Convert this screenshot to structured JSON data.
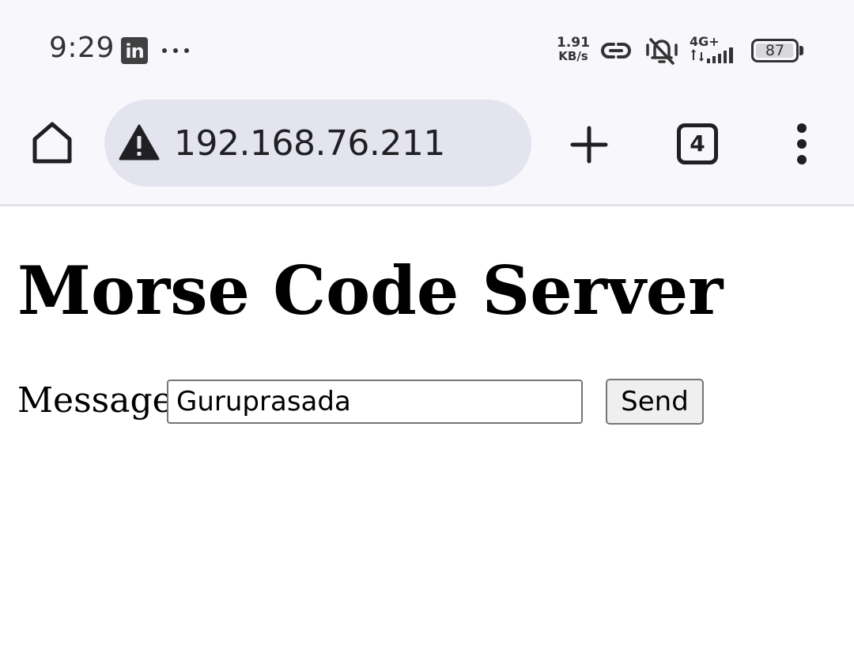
{
  "status_bar": {
    "time": "9:29",
    "notification_icons": [
      "linkedin-icon",
      "more-dots-icon"
    ],
    "net_speed_value": "1.91",
    "net_speed_unit": "KB/s",
    "battery_level": "87",
    "icons": [
      "hotspot-link-icon",
      "vibrate-silent-icon",
      "signal-4g-plus-icon",
      "battery-icon"
    ]
  },
  "toolbar": {
    "url": "192.168.76.211",
    "security_icon": "warning-icon",
    "tab_count": "4",
    "buttons": [
      "home-icon",
      "plus-icon",
      "tab-switcher-icon",
      "kebab-menu-icon"
    ]
  },
  "page": {
    "title": "Morse Code Server",
    "message_label": "Message:",
    "message_value": "Guruprasada",
    "send_label": "Send"
  },
  "colors": {
    "chrome_bg": "#f7f7fc",
    "omnibox_bg": "#e4e4ef",
    "icon_dark": "#1f1f24",
    "status_text": "#333333"
  }
}
